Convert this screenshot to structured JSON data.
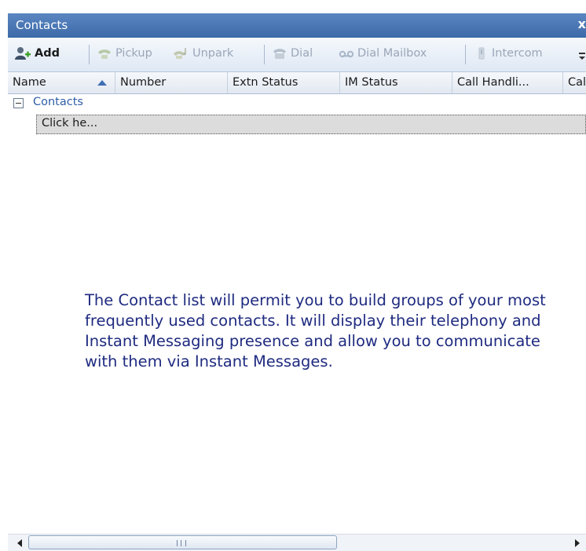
{
  "panel": {
    "title": "Contacts",
    "close_label": "x"
  },
  "toolbar": {
    "add_label": "Add",
    "pickup_label": "Pickup",
    "unpark_label": "Unpark",
    "dial_label": "Dial",
    "dial_mailbox_label": "Dial Mailbox",
    "intercom_label": "Intercom"
  },
  "columns": [
    "Name",
    "Number",
    "Extn Status",
    "IM Status",
    "Call Handli...",
    "Call H"
  ],
  "group": {
    "label": "Contacts"
  },
  "new_row": {
    "label": "Click he..."
  },
  "empty_message": "The Contact list will permit you to build groups of your most frequently used contacts. It will display their telephony and Instant Messaging presence and allow you to communicate with them via Instant Messages.",
  "colors": {
    "titlebar": "#4a78b8",
    "link_blue": "#2f5ea8",
    "message": "#1f2b80"
  }
}
